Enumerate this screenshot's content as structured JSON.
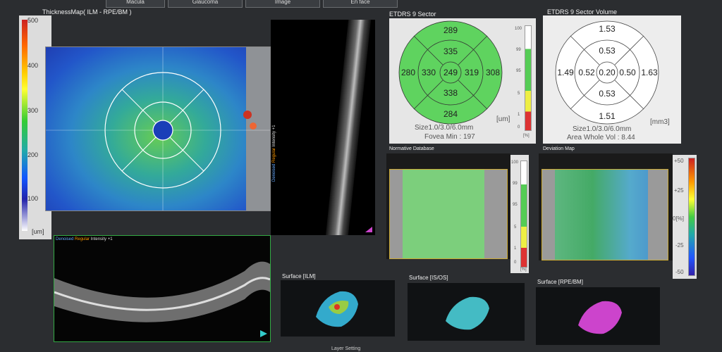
{
  "tabs": [
    "Macula",
    "Glaucoma",
    "Image",
    "En face"
  ],
  "thickness_map": {
    "title": "ThicknessMap( ILM - RPE/BM )",
    "scale_ticks": [
      "500",
      "400",
      "300",
      "200",
      "100"
    ],
    "unit": "[um]"
  },
  "bscan_label": {
    "part1": "Denoised ",
    "part2": "Regular",
    "part3": " Intensity +1"
  },
  "etdrs_sector": {
    "title": "ETDRS 9 Sector",
    "values": {
      "superior_outer": "289",
      "superior_inner": "335",
      "temporal_outer": "280",
      "temporal_inner": "330",
      "center": "249",
      "nasal_inner": "319",
      "nasal_outer": "308",
      "inferior_inner": "338",
      "inferior_outer": "284"
    },
    "unit": "[um]",
    "size": "Size1.0/3.0/6.0mm",
    "fovea_min": "Fovea Min : 197",
    "pct_ticks": [
      "100",
      "99",
      "95",
      "5",
      "1",
      "0",
      "[%]"
    ]
  },
  "etdrs_volume": {
    "title": "ETDRS 9 Sector Volume",
    "values": {
      "superior_outer": "1.53",
      "superior_inner": "0.53",
      "temporal_outer": "1.49",
      "temporal_inner": "0.52",
      "center": "0.20",
      "nasal_inner": "0.50",
      "nasal_outer": "1.63",
      "inferior_inner": "0.53",
      "inferior_outer": "1.51"
    },
    "unit": "[mm3]",
    "size": "Size1.0/3.0/6.0mm",
    "area_vol": "Area Whole Vol : 8.44"
  },
  "normative": {
    "title": "Normative Database",
    "ticks": [
      "100",
      "99",
      "95",
      "5",
      "1",
      "0"
    ],
    "unit": "[%]"
  },
  "deviation": {
    "title": "Deviation Map",
    "ticks": [
      "+50",
      "+25",
      "0[%]",
      "-25",
      "-50"
    ]
  },
  "surfaces": [
    {
      "title": "Surface [ILM]"
    },
    {
      "title": "Surface [IS/OS]"
    },
    {
      "title": "Surface [RPE/BM]"
    }
  ],
  "bottom_label": "Layer Setting"
}
